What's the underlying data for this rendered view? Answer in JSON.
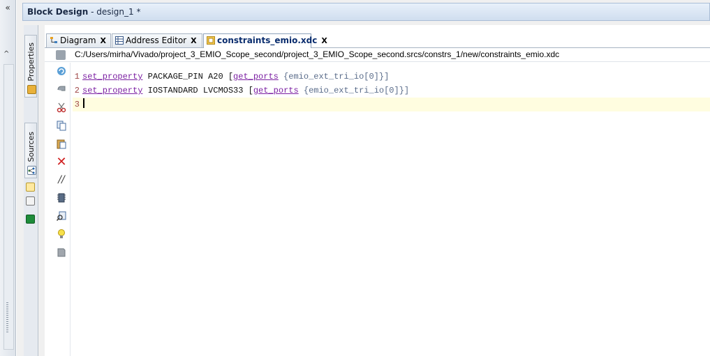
{
  "left_strip": {
    "collapse_icon": "«",
    "scroll_up_icon": "^"
  },
  "window": {
    "title_bold": "Block Design",
    "title_rest": " - design_1 *"
  },
  "side_tabs": [
    {
      "label": "Properties",
      "icon": "properties-icon"
    },
    {
      "label": "Sources",
      "icon": "sources-icon"
    }
  ],
  "tabs": [
    {
      "label": "Diagram",
      "close": "X",
      "icon": "diagram-icon",
      "active": false
    },
    {
      "label": "Address Editor",
      "close": "X",
      "icon": "address-editor-icon",
      "active": false
    },
    {
      "label": "constraints_emio.xdc",
      "close": "X",
      "icon": "xdc-file-icon",
      "active": true
    }
  ],
  "file_path": "C:/Users/mirha/Vivado/project_3_EMIO_Scope_second/project_3_EMIO_Scope_second.srcs/constrs_1/new/constraints_emio.xdc",
  "editor": {
    "lines": [
      {
        "num": "1",
        "cmd": "set_property",
        "mid": " PACKAGE_PIN A20 [",
        "cmd2": "get_ports",
        "tail": " {emio_ext_tri_io[0]}]"
      },
      {
        "num": "2",
        "cmd": "set_property",
        "mid": " IOSTANDARD LVCMOS33 [",
        "cmd2": "get_ports",
        "tail": " {emio_ext_tri_io[0]}]"
      },
      {
        "num": "3",
        "cmd": "",
        "mid": "",
        "cmd2": "",
        "tail": ""
      }
    ],
    "current_line": 3
  },
  "toolbar_icons": [
    "reload-icon",
    "undo-icon",
    "cut-icon",
    "copy-icon",
    "paste-icon",
    "delete-icon",
    "comment-icon",
    "insert-template-icon",
    "find-icon",
    "hint-icon",
    "toggle-icon"
  ],
  "colors": {
    "keyword": "#7b1fa2",
    "line_number": "#a04848",
    "current_line": "#fffde0",
    "delete": "#d02020"
  }
}
